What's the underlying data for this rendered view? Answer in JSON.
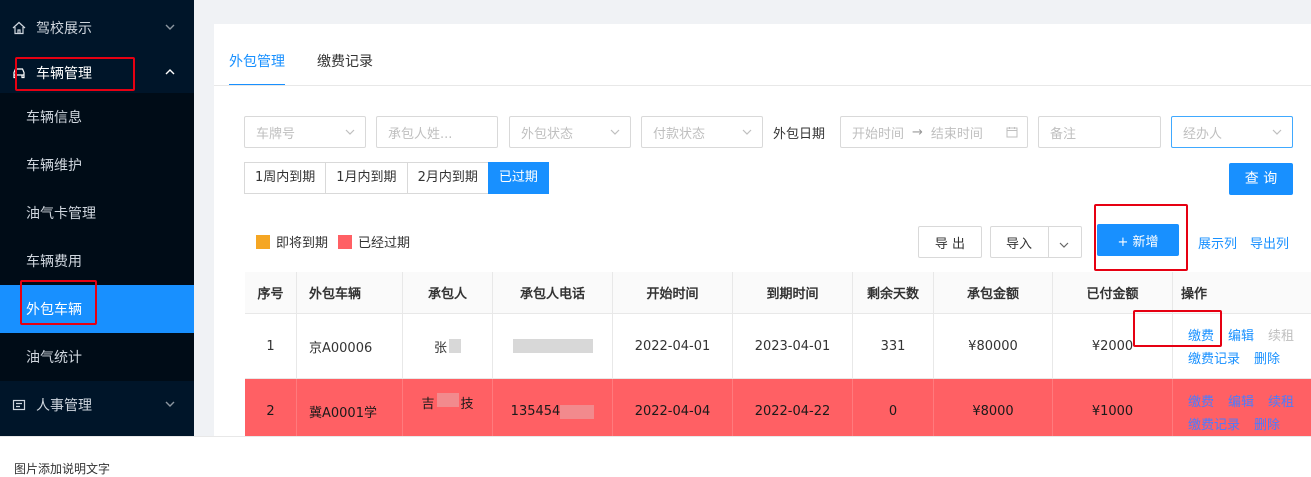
{
  "sidebar": {
    "items": [
      {
        "label": "驾校展示",
        "icon": "home-icon"
      },
      {
        "label": "车辆管理",
        "icon": "car-icon"
      },
      {
        "label": "人事管理",
        "icon": "person-card-icon"
      }
    ],
    "submenu": [
      "车辆信息",
      "车辆维护",
      "油气卡管理",
      "车辆费用",
      "外包车辆",
      "油气统计"
    ]
  },
  "tabs": [
    "外包管理",
    "缴费记录"
  ],
  "filters": {
    "plate": "车牌号",
    "contractor_name": "承包人姓...",
    "outsource_status": "外包状态",
    "payment_status": "付款状态",
    "date_label": "外包日期",
    "start_time": "开始时间",
    "date_sep": "→",
    "end_time": "结束时间",
    "remark": "备注",
    "handler": "经办人"
  },
  "quick_ranges": [
    "1周内到期",
    "1月内到期",
    "2月内到期",
    "已过期"
  ],
  "quick_range_selected": "已过期",
  "query_label": "查 询",
  "legend": {
    "soon": "即将到期",
    "expired": "已经过期",
    "soon_color": "#f5a623",
    "expired_color": "#ff6064"
  },
  "toolbar": {
    "export": "导 出",
    "import": "导入",
    "add": "+ 新增",
    "show_cols": "展示列",
    "export_cols": "导出列"
  },
  "table": {
    "headers": [
      "序号",
      "外包车辆",
      "承包人",
      "承包人电话",
      "开始时间",
      "到期时间",
      "剩余天数",
      "承包金额",
      "已付金额",
      "操作"
    ],
    "rows": [
      {
        "no": "1",
        "vehicle": "京A00006",
        "contractor": "张",
        "phone": "",
        "start": "2022-04-01",
        "end": "2023-04-01",
        "days": "331",
        "amount": "¥80000",
        "paid": "¥2000"
      },
      {
        "no": "2",
        "vehicle": "冀A0001学",
        "contractor_a": "吉",
        "contractor_b": "技",
        "phone": "135454",
        "start": "2022-04-04",
        "end": "2022-04-22",
        "days": "0",
        "amount": "¥8000",
        "paid": "¥1000"
      }
    ],
    "ops": {
      "pay": "缴费",
      "edit": "编辑",
      "renew": "续租",
      "records": "缴费记录",
      "delete": "删除"
    }
  },
  "caption": "图片添加说明文字"
}
